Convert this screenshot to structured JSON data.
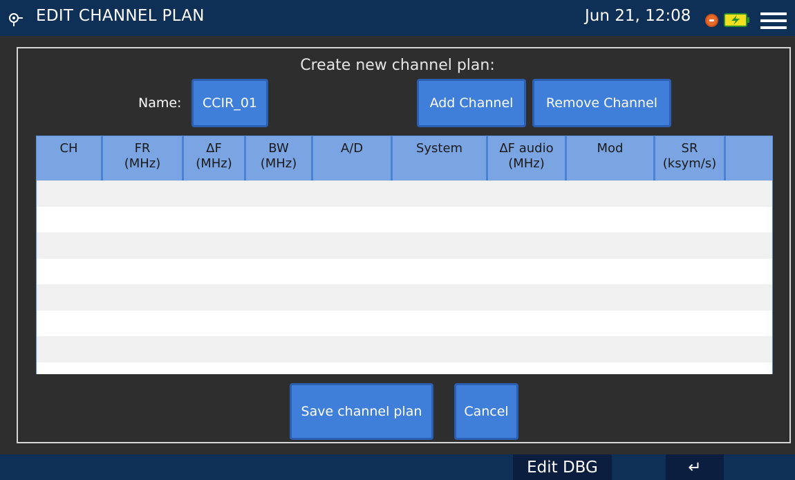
{
  "header": {
    "title": "EDIT CHANNEL PLAN",
    "datetime": "Jun 21, 12:08"
  },
  "form": {
    "heading": "Create new channel plan:",
    "name_label": "Name:",
    "name_value": "CCIR_01",
    "add_channel": "Add Channel",
    "remove_channel": "Remove Channel",
    "save": "Save channel plan",
    "cancel": "Cancel"
  },
  "table": {
    "columns": [
      {
        "line1": "CH",
        "line2": ""
      },
      {
        "line1": "FR",
        "line2": "(MHz)"
      },
      {
        "line1": "ΔF",
        "line2": "(MHz)"
      },
      {
        "line1": "BW",
        "line2": "(MHz)"
      },
      {
        "line1": "A/D",
        "line2": ""
      },
      {
        "line1": "System",
        "line2": ""
      },
      {
        "line1": "ΔF audio",
        "line2": "(MHz)"
      },
      {
        "line1": "Mod",
        "line2": ""
      },
      {
        "line1": "SR",
        "line2": "(ksym/s)"
      },
      {
        "line1": "",
        "line2": ""
      }
    ],
    "rows": []
  },
  "footer": {
    "softkey_edit": "Edit DBG",
    "softkey_back": "↵"
  },
  "colors": {
    "topbar": "#0e2f56",
    "button": "#3f7fd9",
    "table_header": "#7ba4e2",
    "background": "#2e2e2e"
  }
}
